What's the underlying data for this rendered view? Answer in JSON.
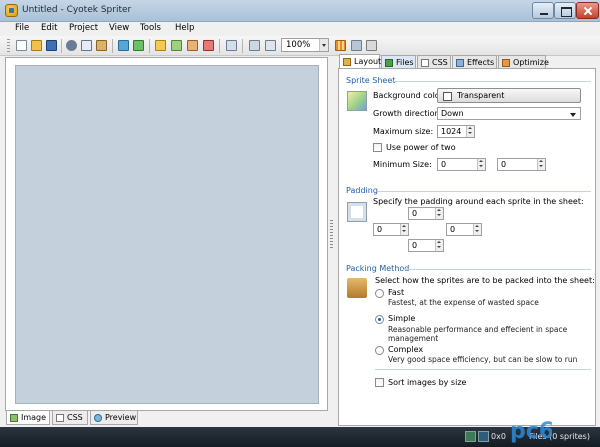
{
  "window": {
    "title": "Untitled - Cyotek Spriter"
  },
  "menu": [
    "File",
    "Edit",
    "Project",
    "View",
    "Tools",
    "Help"
  ],
  "toolbar": {
    "zoom": "100%",
    "icons": [
      "new-icon",
      "open-icon",
      "save-icon",
      "cut-icon",
      "copy-icon",
      "paste-icon",
      "import-icon",
      "export-icon",
      "sprite-icon",
      "add-image-icon",
      "image-icon",
      "remove-icon",
      "pack-icon",
      "view-icon",
      "preview-icon",
      "grid-icon",
      "option-icon",
      "color-icon"
    ]
  },
  "bottom_tabs": [
    "Image",
    "CSS",
    "Preview"
  ],
  "right_tabs": [
    "Layout",
    "Files",
    "CSS",
    "Effects",
    "Optimize"
  ],
  "layout": {
    "sprite_sheet": {
      "title": "Sprite Sheet",
      "background_color_label": "Background color:",
      "background_color_value": "Transparent",
      "growth_direction_label": "Growth direction:",
      "growth_direction_value": "Down",
      "maximum_size_label": "Maximum size:",
      "maximum_size_value": "1024",
      "use_power_of_two_label": "Use power of two",
      "minimum_size_label": "Minimum Size:",
      "minimum_size_width": "0",
      "minimum_size_height": "0"
    },
    "padding": {
      "title": "Padding",
      "description": "Specify the padding around each sprite in the sheet:",
      "top": "0",
      "left": "0",
      "right": "0",
      "bottom": "0"
    },
    "packing": {
      "title": "Packing Method",
      "description": "Select how the sprites are to be packed into the sheet:",
      "options": [
        {
          "label": "Fast",
          "desc1": "Fastest, at the expense of wasted space",
          "desc2": ""
        },
        {
          "label": "Simple",
          "desc1": "Reasonable performance and effecient in space",
          "desc2": "management"
        },
        {
          "label": "Complex",
          "desc1": "Very good space efficiency, but can be slow to run",
          "desc2": ""
        }
      ],
      "selected": "Simple",
      "sort_label": "Sort images by size"
    }
  },
  "status": {
    "coords": "0x0",
    "files": "Files (0 sprites)"
  },
  "colors": {
    "canvas": "#c4d0db",
    "section_title": "#1e5fa8",
    "statusbar": "#1d242c"
  }
}
